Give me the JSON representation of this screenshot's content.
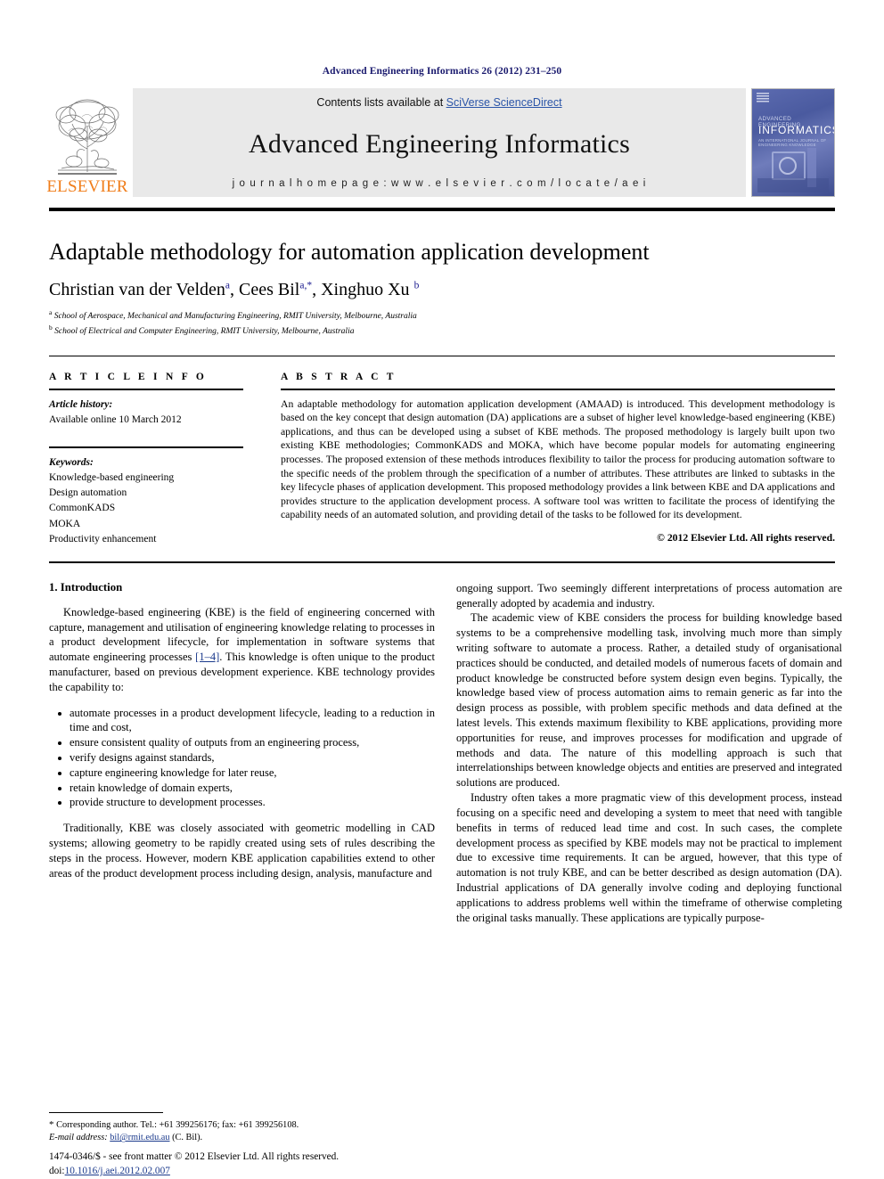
{
  "running_head": "Advanced Engineering Informatics 26 (2012) 231–250",
  "masthead": {
    "publisher": "ELSEVIER",
    "contents_prefix": "Contents lists available at ",
    "contents_link": "SciVerse ScienceDirect",
    "journal_title": "Advanced Engineering Informatics",
    "homepage": "j o u r n a l   h o m e p a g e :   w w w . e l s e v i e r . c o m / l o c a t e / a e i",
    "cover": {
      "line1": "ADVANCED ENGINEERING",
      "line2": "INFORMATICS",
      "line3": "AN INTERNATIONAL JOURNAL OF ENGINEERING KNOWLEDGE"
    }
  },
  "article": {
    "title": "Adaptable methodology for automation application development",
    "authors_html": "Christian van der Velden<sup>a</sup>, Cees Bil<sup>a,*</sup>, Xinghuo Xu <sup>b</sup>",
    "affiliation_a": "School of Aerospace, Mechanical and Manufacturing Engineering, RMIT University, Melbourne, Australia",
    "affiliation_b": "School of Electrical and Computer Engineering, RMIT University, Melbourne, Australia",
    "affiliation_a_marker": "a",
    "affiliation_b_marker": "b"
  },
  "article_info": {
    "heading": "A R T I C L E    I N F O",
    "history_label": "Article history:",
    "history_value": "Available online 10 March 2012",
    "keywords_label": "Keywords:",
    "keywords": [
      "Knowledge-based engineering",
      "Design automation",
      "CommonKADS",
      "MOKA",
      "Productivity enhancement"
    ]
  },
  "abstract": {
    "heading": "A B S T R A C T",
    "text": "An adaptable methodology for automation application development (AMAAD) is introduced. This development methodology is based on the key concept that design automation (DA) applications are a subset of higher level knowledge-based engineering (KBE) applications, and thus can be developed using a subset of KBE methods. The proposed methodology is largely built upon two existing KBE methodologies; CommonKADS and MOKA, which have become popular models for automating engineering processes. The proposed extension of these methods introduces flexibility to tailor the process for producing automation software to the specific needs of the problem through the specification of a number of attributes. These attributes are linked to subtasks in the key lifecycle phases of application development. This proposed methodology provides a link between KBE and DA applications and provides structure to the application development process. A software tool was written to facilitate the process of identifying the capability needs of an automated solution, and providing detail of the tasks to be followed for its development.",
    "copyright": "© 2012 Elsevier Ltd. All rights reserved."
  },
  "body": {
    "section_heading": "1. Introduction",
    "left_para_1_pre": "Knowledge-based engineering (KBE) is the field of engineering concerned with capture, management and utilisation of engineering knowledge relating to processes in a product development lifecycle, for implementation in software systems that automate engineering processes ",
    "left_para_1_ref": "[1–4]",
    "left_para_1_post": ". This knowledge is often unique to the product manufacturer, based on previous development experience. KBE technology provides the capability to:",
    "bullets": [
      "automate processes in a product development lifecycle, leading to a reduction in time and cost,",
      "ensure consistent quality of outputs from an engineering process,",
      "verify designs against standards,",
      "capture engineering knowledge for later reuse,",
      "retain knowledge of domain experts,",
      "provide structure to development processes."
    ],
    "left_para_2": "Traditionally, KBE was closely associated with geometric modelling in CAD systems; allowing geometry to be rapidly created using sets of rules describing the steps in the process. However, modern KBE application capabilities extend to other areas of the product development process including design, analysis, manufacture and",
    "right_para_1": "ongoing support. Two seemingly different interpretations of process automation are generally adopted by academia and industry.",
    "right_para_2": "The academic view of KBE considers the process for building knowledge based systems to be a comprehensive modelling task, involving much more than simply writing software to automate a process. Rather, a detailed study of organisational practices should be conducted, and detailed models of numerous facets of domain and product knowledge be constructed before system design even begins. Typically, the knowledge based view of process automation aims to remain generic as far into the design process as possible, with problem specific methods and data defined at the latest levels. This extends maximum flexibility to KBE applications, providing more opportunities for reuse, and improves processes for modification and upgrade of methods and data. The nature of this modelling approach is such that interrelationships between knowledge objects and entities are preserved and integrated solutions are produced.",
    "right_para_3": "Industry often takes a more pragmatic view of this development process, instead focusing on a specific need and developing a system to meet that need with tangible benefits in terms of reduced lead time and cost. In such cases, the complete development process as specified by KBE models may not be practical to implement due to excessive time requirements. It can be argued, however, that this type of automation is not truly KBE, and can be better described as design automation (DA). Industrial applications of DA generally involve coding and deploying functional applications to address problems well within the timeframe of otherwise completing the original tasks manually. These applications are typically purpose-"
  },
  "footnote": {
    "star": "*",
    "corresponding": "Corresponding author. Tel.: +61 399256176; fax: +61 399256108.",
    "email_label": "E-mail address:",
    "email": "bil@rmit.edu.au",
    "email_suffix": "(C. Bil)."
  },
  "imprint": {
    "line1": "1474-0346/$ - see front matter © 2012 Elsevier Ltd. All rights reserved.",
    "doi_prefix": "doi:",
    "doi": "10.1016/j.aei.2012.02.007"
  },
  "colors": {
    "running_head": "#1a1a6e",
    "link": "#1b3a8c",
    "elsevier_orange": "#f07d1a",
    "band_bg": "#e9e9e9"
  }
}
